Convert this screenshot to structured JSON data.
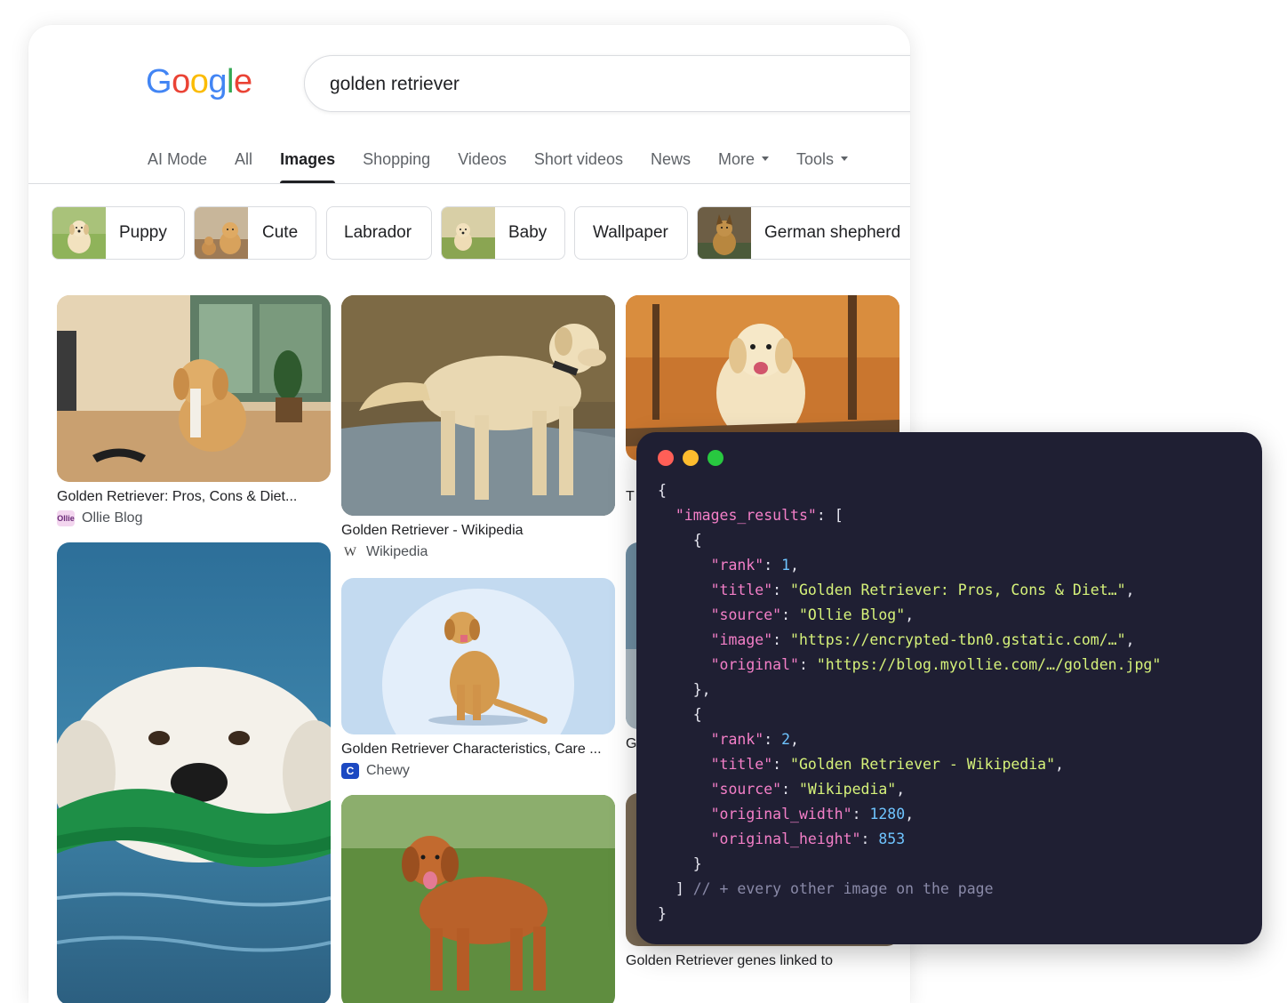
{
  "search": {
    "logo_text": "Google",
    "logo_letters": [
      "G",
      "o",
      "o",
      "g",
      "l",
      "e"
    ],
    "logo_colors": [
      "#4285f4",
      "#ea4335",
      "#fbbc05",
      "#4285f4",
      "#34a853",
      "#ea4335"
    ],
    "query": "golden retriever"
  },
  "tabs": [
    {
      "label": "AI Mode",
      "active": false
    },
    {
      "label": "All",
      "active": false
    },
    {
      "label": "Images",
      "active": true
    },
    {
      "label": "Shopping",
      "active": false
    },
    {
      "label": "Videos",
      "active": false
    },
    {
      "label": "Short videos",
      "active": false
    },
    {
      "label": "News",
      "active": false
    },
    {
      "label": "More",
      "active": false,
      "dropdown": true
    },
    {
      "label": "Tools",
      "active": false,
      "dropdown": true
    }
  ],
  "chips": [
    {
      "label": "Puppy",
      "has_thumb": true
    },
    {
      "label": "Cute",
      "has_thumb": true
    },
    {
      "label": "Labrador",
      "has_thumb": false
    },
    {
      "label": "Baby",
      "has_thumb": true
    },
    {
      "label": "Wallpaper",
      "has_thumb": false
    },
    {
      "label": "German shepherd",
      "has_thumb": true
    }
  ],
  "results": [
    {
      "title": "Golden Retriever: Pros, Cons & Diet...",
      "source": "Ollie Blog",
      "source_icon": "ollie-icon",
      "source_icon_text": "Ollie"
    },
    {
      "title": "Golden Retriever - Wikipedia",
      "source": "Wikipedia",
      "source_icon": "wikipedia-icon",
      "source_icon_text": "W"
    },
    {
      "title": "Golden Retriever Characteristics, Care ...",
      "source": "Chewy",
      "source_icon": "chewy-icon",
      "source_icon_text": "C"
    },
    {
      "title_partial": "T"
    },
    {
      "title_partial": "G"
    },
    {
      "title_partial": "Golden Retriever genes linked to"
    }
  ],
  "code_panel": {
    "window_dots": [
      "#ff5f57",
      "#febc2e",
      "#28c840"
    ],
    "lines": [
      [
        [
          "p",
          "{"
        ]
      ],
      [
        [
          "p",
          "  "
        ],
        [
          "k",
          "\"images_results\""
        ],
        [
          "p",
          ": ["
        ]
      ],
      [
        [
          "p",
          "    {"
        ]
      ],
      [
        [
          "p",
          "      "
        ],
        [
          "k",
          "\"rank\""
        ],
        [
          "p",
          ": "
        ],
        [
          "n",
          "1"
        ],
        [
          "p",
          ","
        ]
      ],
      [
        [
          "p",
          "      "
        ],
        [
          "k",
          "\"title\""
        ],
        [
          "p",
          ": "
        ],
        [
          "s",
          "\"Golden Retriever: Pros, Cons & Diet…\""
        ],
        [
          "p",
          ","
        ]
      ],
      [
        [
          "p",
          "      "
        ],
        [
          "k",
          "\"source\""
        ],
        [
          "p",
          ": "
        ],
        [
          "s",
          "\"Ollie Blog\""
        ],
        [
          "p",
          ","
        ]
      ],
      [
        [
          "p",
          "      "
        ],
        [
          "k",
          "\"image\""
        ],
        [
          "p",
          ": "
        ],
        [
          "s",
          "\"https://encrypted-tbn0.gstatic.com/…\""
        ],
        [
          "p",
          ","
        ]
      ],
      [
        [
          "p",
          "      "
        ],
        [
          "k",
          "\"original\""
        ],
        [
          "p",
          ": "
        ],
        [
          "s",
          "\"https://blog.myollie.com/…/golden.jpg\""
        ]
      ],
      [
        [
          "p",
          "    },"
        ]
      ],
      [
        [
          "p",
          "    {"
        ]
      ],
      [
        [
          "p",
          "      "
        ],
        [
          "k",
          "\"rank\""
        ],
        [
          "p",
          ": "
        ],
        [
          "n",
          "2"
        ],
        [
          "p",
          ","
        ]
      ],
      [
        [
          "p",
          "      "
        ],
        [
          "k",
          "\"title\""
        ],
        [
          "p",
          ": "
        ],
        [
          "s",
          "\"Golden Retriever - Wikipedia\""
        ],
        [
          "p",
          ","
        ]
      ],
      [
        [
          "p",
          "      "
        ],
        [
          "k",
          "\"source\""
        ],
        [
          "p",
          ": "
        ],
        [
          "s",
          "\"Wikipedia\""
        ],
        [
          "p",
          ","
        ]
      ],
      [
        [
          "p",
          "      "
        ],
        [
          "k",
          "\"original_width\""
        ],
        [
          "p",
          ": "
        ],
        [
          "n",
          "1280"
        ],
        [
          "p",
          ","
        ]
      ],
      [
        [
          "p",
          "      "
        ],
        [
          "k",
          "\"original_height\""
        ],
        [
          "p",
          ": "
        ],
        [
          "n",
          "853"
        ]
      ],
      [
        [
          "p",
          "    }"
        ]
      ],
      [
        [
          "p",
          "  ] "
        ],
        [
          "c",
          "// + every other image on the page"
        ]
      ],
      [
        [
          "p",
          "}"
        ]
      ]
    ]
  }
}
